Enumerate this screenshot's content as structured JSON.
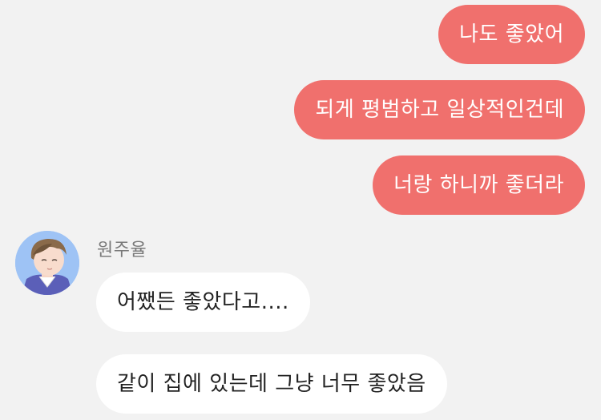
{
  "conversation": {
    "outgoing": [
      {
        "text": "나도 좋았어"
      },
      {
        "text": "되게 평범하고 일상적인건데"
      },
      {
        "text": "너랑 하니까 좋더라"
      }
    ],
    "contact": {
      "name": "원주율",
      "avatar_icon": "profile-avatar-icon"
    },
    "incoming": [
      {
        "text": "어쨌든 좋았다고...."
      },
      {
        "text": "같이 집에 있는데 그냥 너무 좋았음"
      }
    ]
  },
  "colors": {
    "background": "#f2f2f2",
    "outgoing_bubble": "#f0706d",
    "incoming_bubble": "#ffffff",
    "avatar_bg": "#9ec3f5"
  }
}
